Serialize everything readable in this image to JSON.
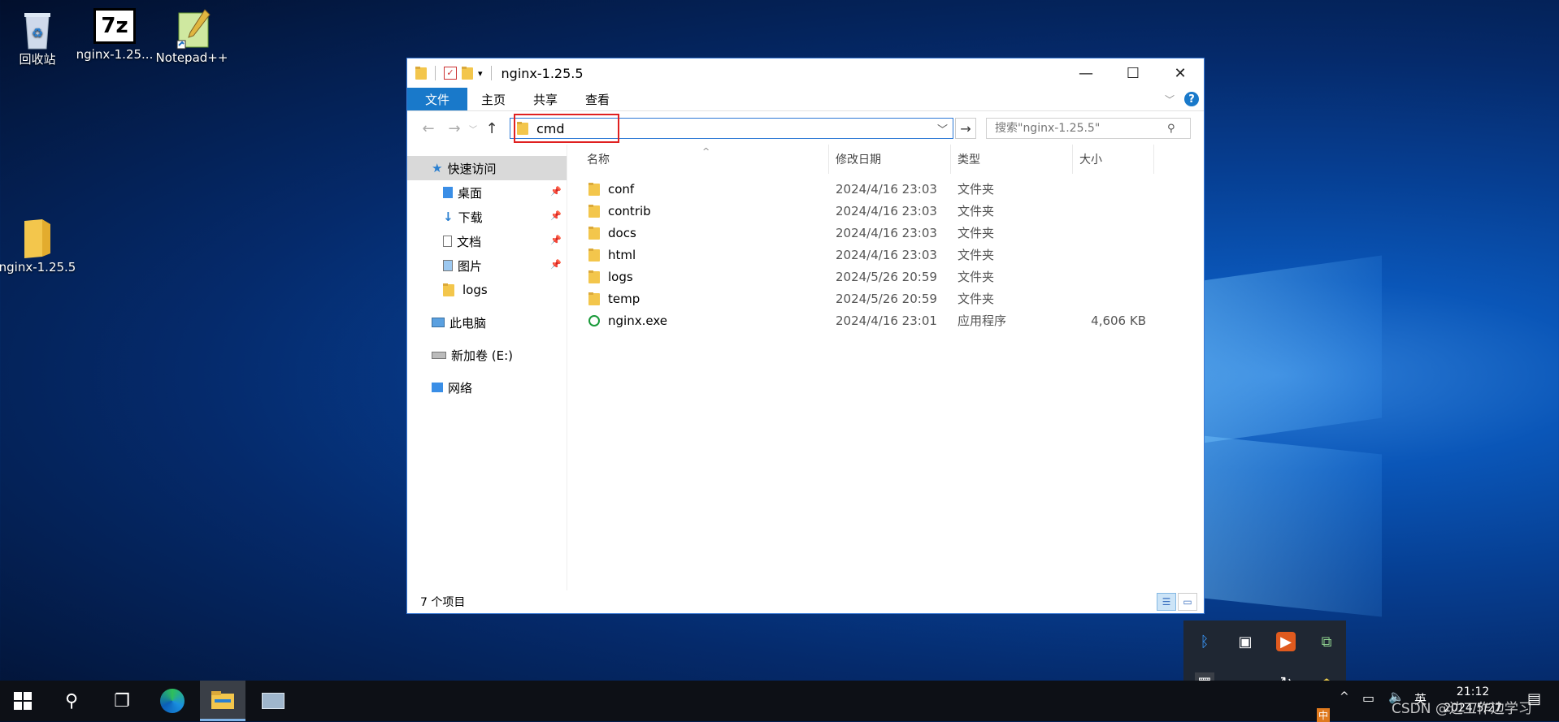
{
  "desktop": {
    "icons": [
      {
        "label": "回收站"
      },
      {
        "label": "nginx-1.25..."
      },
      {
        "label": "Notepad++"
      },
      {
        "label": "nginx-1.25.5"
      }
    ],
    "seven_zip_glyph": "7z"
  },
  "window": {
    "title": "nginx-1.25.5",
    "controls": {
      "minimize": "—",
      "maximize": "☐",
      "close": "✕"
    },
    "ribbon_tabs": [
      "文件",
      "主页",
      "共享",
      "查看"
    ],
    "help_glyph": "?",
    "address_value": "cmd",
    "search_placeholder": "搜索\"nginx-1.25.5\"",
    "nav": {
      "quick_access": "快速访问",
      "items": [
        "桌面",
        "下载",
        "文档",
        "图片",
        "logs"
      ],
      "this_pc": "此电脑",
      "drive": "新加卷 (E:)",
      "network": "网络"
    },
    "columns": [
      "名称",
      "修改日期",
      "类型",
      "大小"
    ],
    "files": [
      {
        "name": "conf",
        "date": "2024/4/16 23:03",
        "type": "文件夹",
        "size": ""
      },
      {
        "name": "contrib",
        "date": "2024/4/16 23:03",
        "type": "文件夹",
        "size": ""
      },
      {
        "name": "docs",
        "date": "2024/4/16 23:03",
        "type": "文件夹",
        "size": ""
      },
      {
        "name": "html",
        "date": "2024/4/16 23:03",
        "type": "文件夹",
        "size": ""
      },
      {
        "name": "logs",
        "date": "2024/5/26 20:59",
        "type": "文件夹",
        "size": ""
      },
      {
        "name": "temp",
        "date": "2024/5/26 20:59",
        "type": "文件夹",
        "size": ""
      },
      {
        "name": "nginx.exe",
        "date": "2024/4/16 23:01",
        "type": "应用程序",
        "size": "4,606 KB"
      }
    ],
    "status": "7 个项目"
  },
  "taskbar": {
    "clock_time": "21:12",
    "clock_date": "2024/5/27",
    "ime": "英",
    "ime_overflow": "中"
  },
  "watermark": "CSDN @边工作边学习",
  "colors": {
    "accent": "#1979ca",
    "highlight_box": "#e02020",
    "folder": "#f3c64c"
  }
}
